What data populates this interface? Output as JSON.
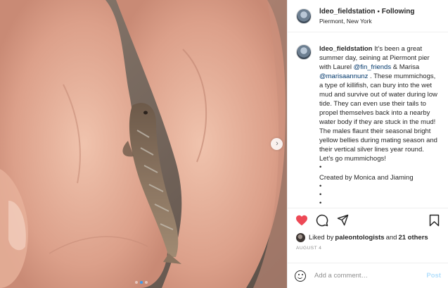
{
  "header": {
    "username": "ldeo_fieldstation",
    "separator": "•",
    "follow_label": "Following",
    "location": "Piermont, New York"
  },
  "caption": {
    "username": "ldeo_fieldstation",
    "text_1": "It’s been a great summer day, seining at Piermont pier with Laurel ",
    "mention_1": "@fin_friends",
    "text_2": " & Marisa ",
    "mention_2": "@marisaannunz",
    "text_3": " . These mummichogs, a type of killifish, can bury into the wet mud and survive out of water during low tide. They can even use their tails to propel themselves back into a nearby water body if they are stuck in the mud! The males flaunt their seasonal bright yellow bellies during mating season and their vertical silver lines year round. Let’s go mummichogs!",
    "bullet": "•",
    "credit": "Created by Monica and Jiaming"
  },
  "likes": {
    "prefix": "Liked by ",
    "liker": "paleontologists",
    "middle": " and ",
    "others": "21 others"
  },
  "date": "AUGUST 4",
  "comment_box": {
    "placeholder": "Add a comment…",
    "post_label": "Post"
  },
  "icons": {
    "like": "heart-filled-icon",
    "comment": "comment-bubble-icon",
    "share": "paper-plane-icon",
    "save": "bookmark-icon",
    "next": "chevron-right-icon",
    "emoji": "smiley-icon"
  },
  "colors": {
    "like_red": "#ed4956",
    "mention_blue": "#00376b",
    "post_disabled": "#b2dffc",
    "muted": "#8e8e8e",
    "active_dot": "#3a9cf0"
  },
  "carousel": {
    "current_index": 1,
    "count": 3
  }
}
